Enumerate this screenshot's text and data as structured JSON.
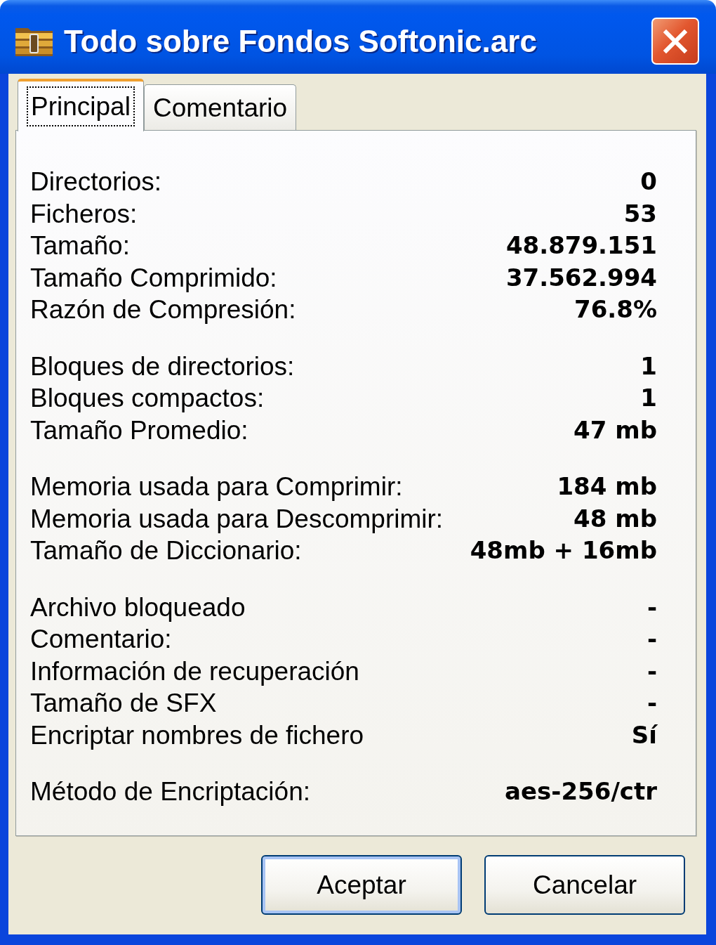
{
  "window": {
    "title": "Todo sobre Fondos Softonic.arc"
  },
  "tabs": [
    {
      "label": "Principal",
      "selected": true,
      "focused": true
    },
    {
      "label": "Comentario",
      "selected": false,
      "focused": false
    }
  ],
  "groups": [
    {
      "rows": [
        {
          "label": "Directorios:",
          "value": "0"
        },
        {
          "label": "Ficheros:",
          "value": "53"
        },
        {
          "label": "Tamaño:",
          "value": "48.879.151"
        },
        {
          "label": "Tamaño Comprimido:",
          "value": "37.562.994"
        },
        {
          "label": "Razón de Compresión:",
          "value": "76.8%"
        }
      ]
    },
    {
      "rows": [
        {
          "label": "Bloques de directorios:",
          "value": "1"
        },
        {
          "label": "Bloques compactos:",
          "value": "1"
        },
        {
          "label": "Tamaño Promedio:",
          "value": "47 mb"
        }
      ]
    },
    {
      "rows": [
        {
          "label": "Memoria usada para Comprimir:",
          "value": "184 mb"
        },
        {
          "label": "Memoria usada para Descomprimir:",
          "value": "48 mb"
        },
        {
          "label": "Tamaño de Diccionario:",
          "value": "48mb + 16mb"
        }
      ]
    },
    {
      "rows": [
        {
          "label": "Archivo bloqueado",
          "value": "-"
        },
        {
          "label": "Comentario:",
          "value": "-"
        },
        {
          "label": "Información de recuperación",
          "value": "-"
        },
        {
          "label": "Tamaño de SFX",
          "value": "-"
        },
        {
          "label": "Encriptar nombres de fichero",
          "value": "Sí"
        }
      ]
    },
    {
      "rows": [
        {
          "label": "Método de Encriptación:",
          "value": "aes-256/ctr"
        }
      ]
    }
  ],
  "buttons": [
    {
      "label": "Aceptar",
      "default": true
    },
    {
      "label": "Cancelar",
      "default": false
    }
  ]
}
